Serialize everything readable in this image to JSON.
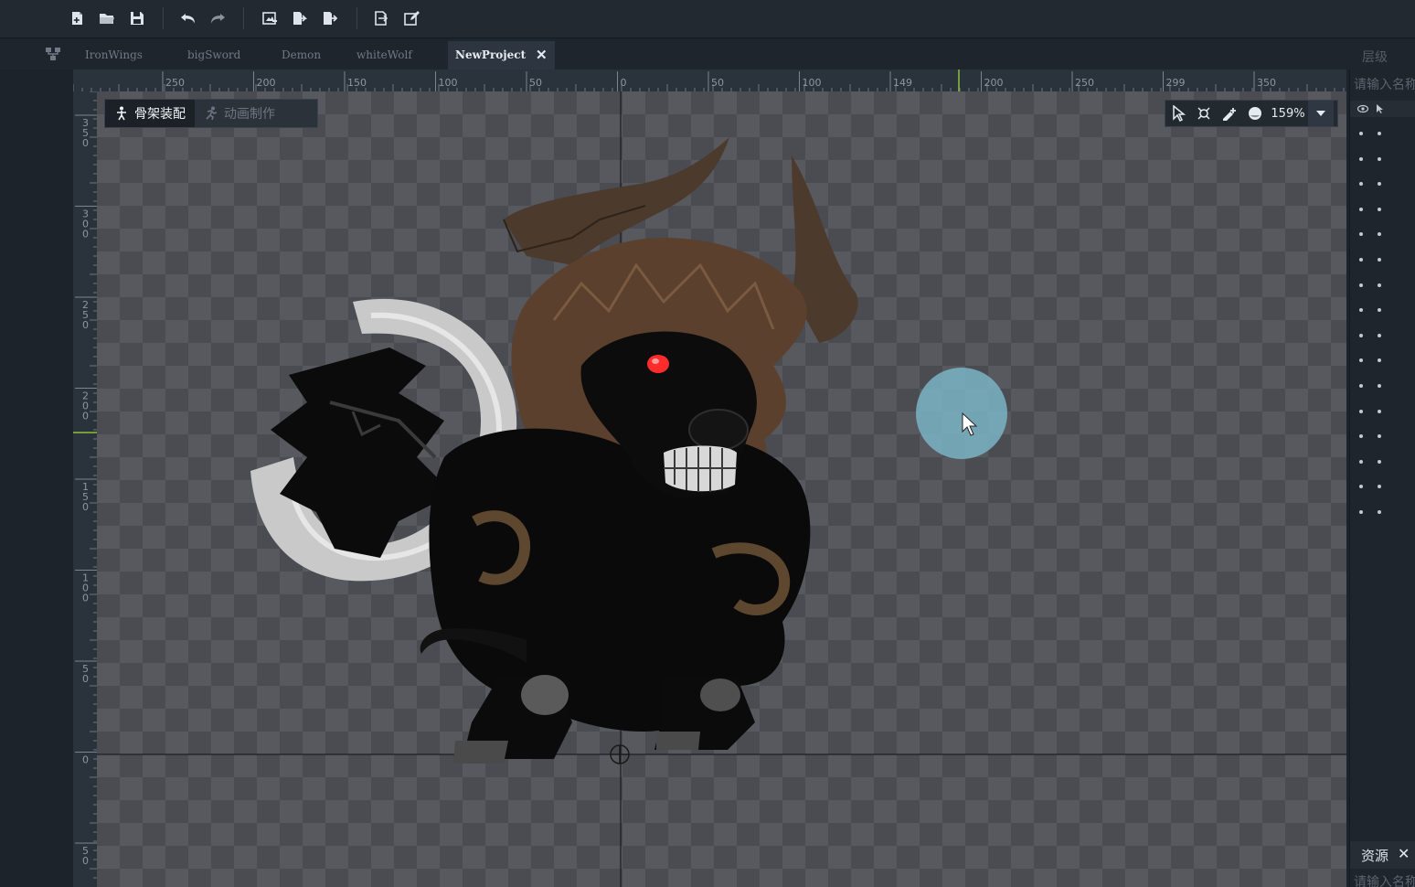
{
  "toolbar": {
    "buttons": [
      "new-project-icon",
      "open-folder-icon",
      "save-icon",
      "undo-icon",
      "redo-icon",
      "import-image-icon",
      "import-folder-icon",
      "export-folder-icon",
      "export-icon",
      "edit-icon"
    ]
  },
  "tabs": {
    "items": [
      {
        "label": "IronWings"
      },
      {
        "label": "bigSword"
      },
      {
        "label": "Demon"
      },
      {
        "label": "whiteWolf"
      },
      {
        "label": "NewProject",
        "active": true
      }
    ],
    "close_symbol": "✕"
  },
  "layers_panel": {
    "title": "层级",
    "search_placeholder": "请输入名称",
    "row_count": 16
  },
  "resources_panel": {
    "title": "资源",
    "close_symbol": "✕",
    "search_placeholder": "请输入名称"
  },
  "mode_switch": {
    "armature_label": "骨架装配",
    "animation_label": "动画制作"
  },
  "view_tools": {
    "zoom": "159%"
  },
  "rulers": {
    "horizontal_labels": [
      "250",
      "200",
      "150",
      "100",
      "50",
      "0",
      "50",
      "100",
      "149",
      "200",
      "250",
      "299",
      "350"
    ],
    "vertical_labels": [
      "350",
      "300",
      "250",
      "200",
      "150",
      "100",
      "50",
      "0",
      "50"
    ]
  },
  "colors": {
    "accent_green": "#8fbf3a",
    "canvas_dark": "#4a4c52",
    "canvas_light": "#58595f",
    "cursor_highlight": "#7ab4c4",
    "eye_red": "#ff3030"
  }
}
